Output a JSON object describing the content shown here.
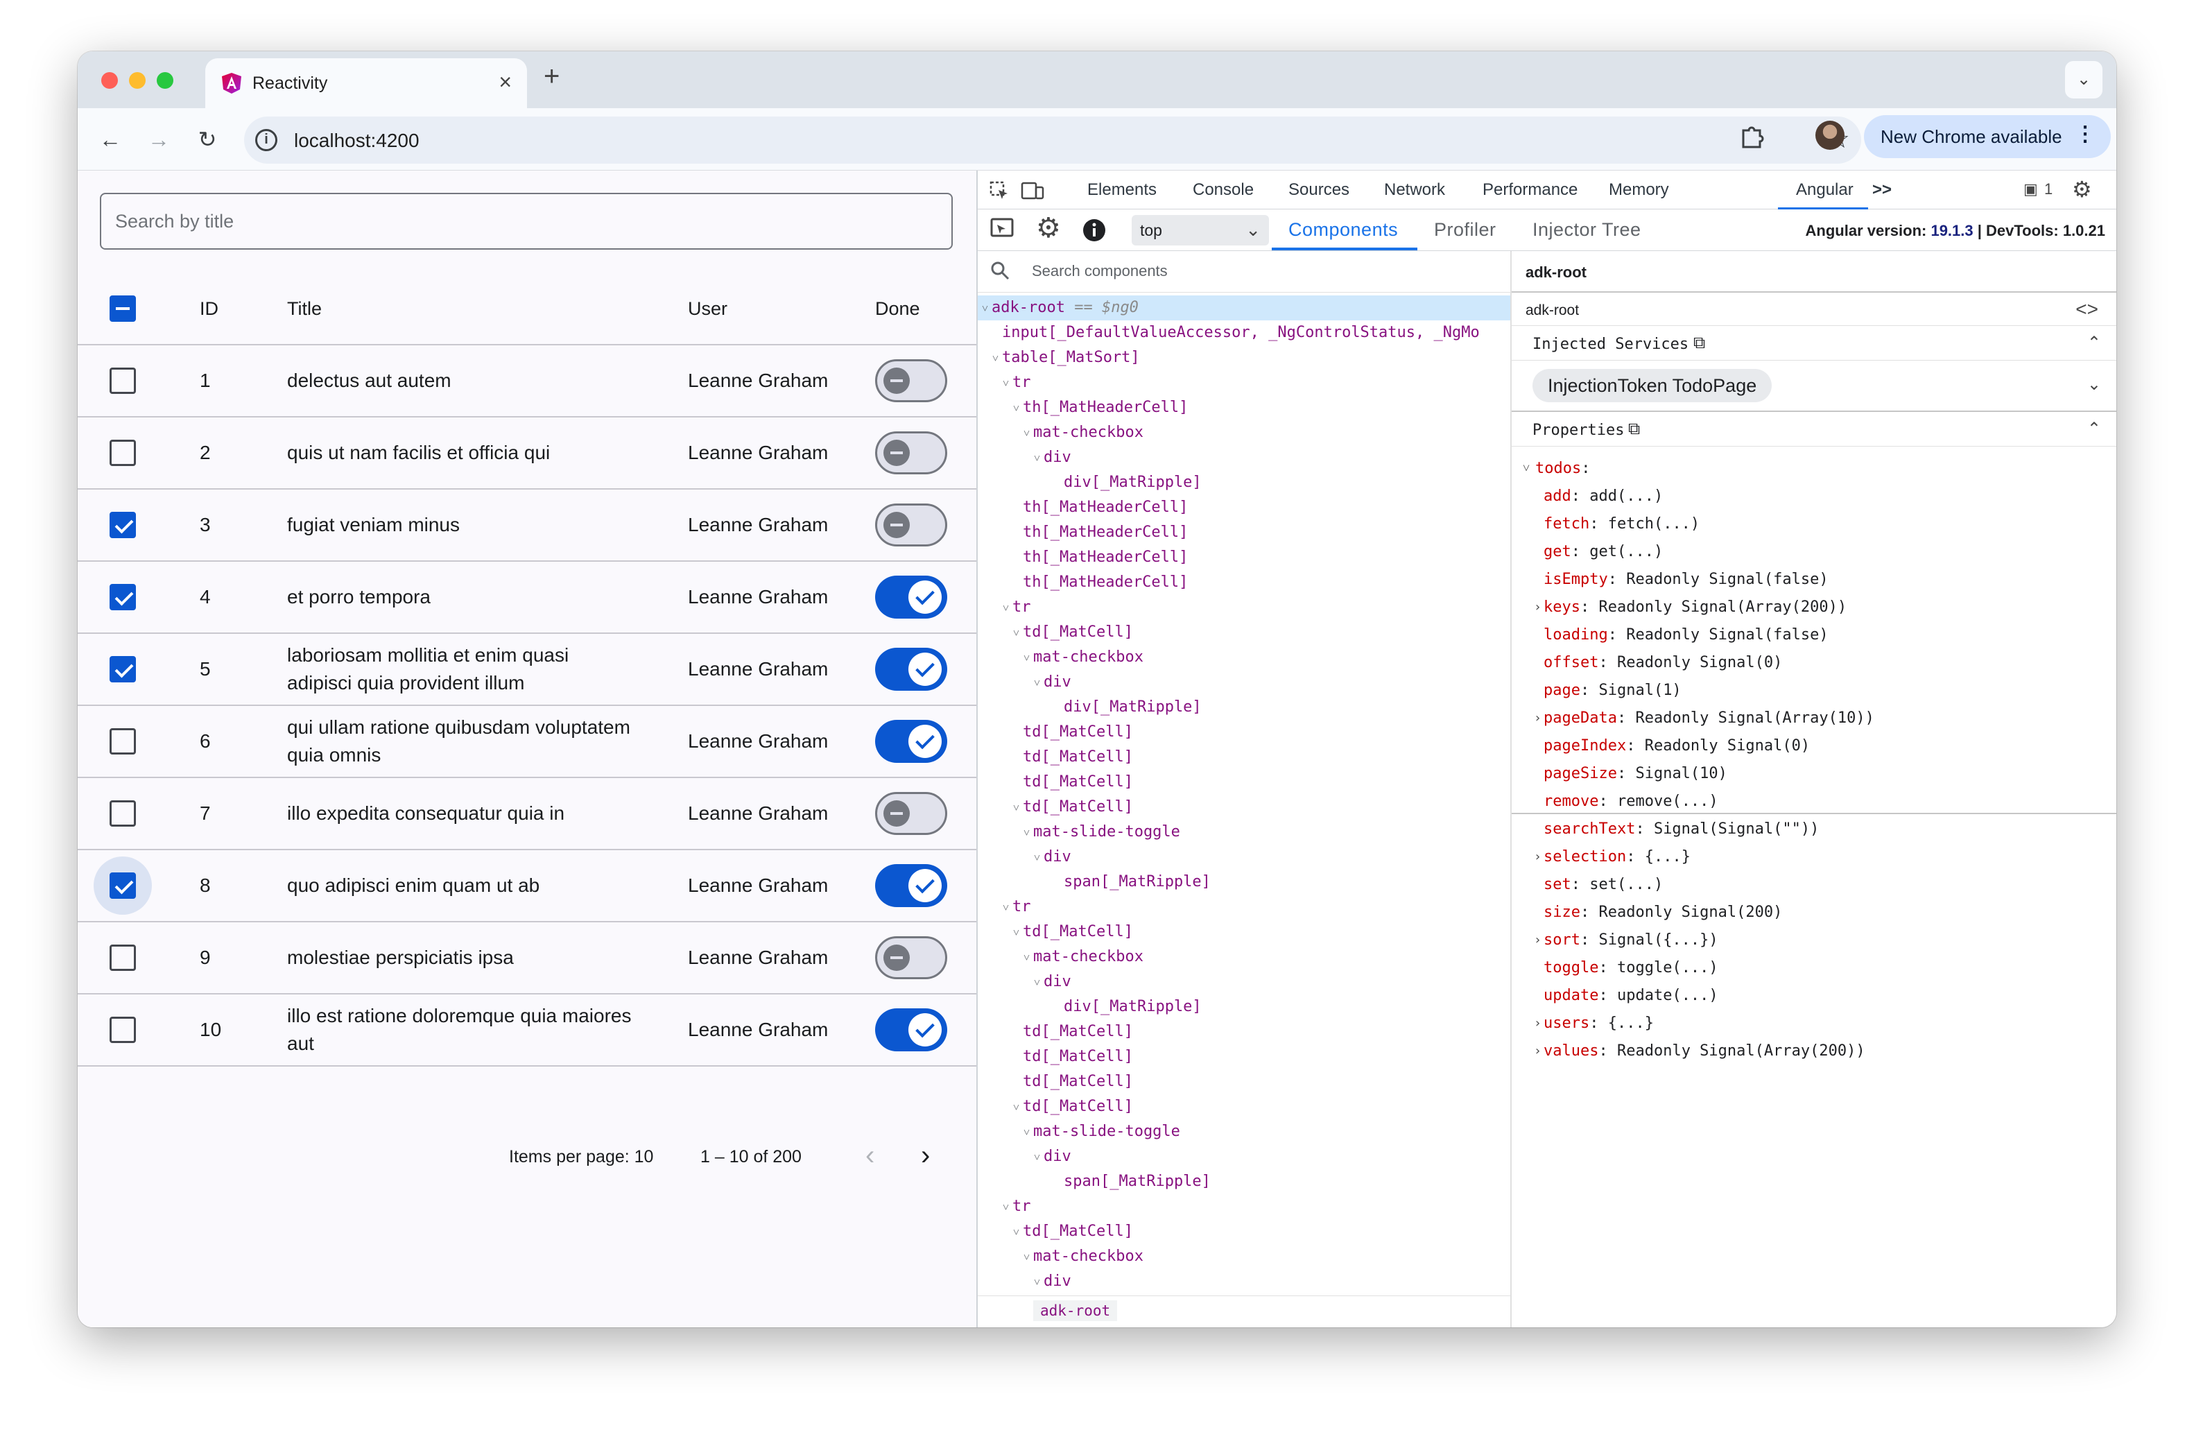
{
  "browser": {
    "tab_title": "Reactivity",
    "tab_close": "×",
    "new_tab": "+",
    "tab_menu": "⌄",
    "url": "localhost:4200",
    "update_label": "New Chrome available",
    "nav": {
      "back": "←",
      "forward": "→",
      "reload": "↻",
      "star": "☆",
      "menu": "⋮"
    }
  },
  "app": {
    "search_placeholder": "Search by title",
    "columns": {
      "id": "ID",
      "title": "Title",
      "user": "User",
      "done": "Done"
    },
    "rows": [
      {
        "id": "1",
        "title": "delectus aut autem",
        "user": "Leanne Graham",
        "selected": false,
        "done": false
      },
      {
        "id": "2",
        "title": "quis ut nam facilis et officia qui",
        "user": "Leanne Graham",
        "selected": false,
        "done": false
      },
      {
        "id": "3",
        "title": "fugiat veniam minus",
        "user": "Leanne Graham",
        "selected": true,
        "done": false
      },
      {
        "id": "4",
        "title": "et porro tempora",
        "user": "Leanne Graham",
        "selected": true,
        "done": true
      },
      {
        "id": "5",
        "title": "laboriosam mollitia et enim quasi adipisci quia provident illum",
        "user": "Leanne Graham",
        "selected": true,
        "done": true
      },
      {
        "id": "6",
        "title": "qui ullam ratione quibusdam voluptatem quia omnis",
        "user": "Leanne Graham",
        "selected": false,
        "done": true
      },
      {
        "id": "7",
        "title": "illo expedita consequatur quia in",
        "user": "Leanne Graham",
        "selected": false,
        "done": false
      },
      {
        "id": "8",
        "title": "quo adipisci enim quam ut ab",
        "user": "Leanne Graham",
        "selected": true,
        "done": true
      },
      {
        "id": "9",
        "title": "molestiae perspiciatis ipsa",
        "user": "Leanne Graham",
        "selected": false,
        "done": false
      },
      {
        "id": "10",
        "title": "illo est ratione doloremque quia maiores aut",
        "user": "Leanne Graham",
        "selected": false,
        "done": true
      }
    ],
    "paginator": {
      "items_per_page": "Items per page: 10",
      "range": "1 – 10 of 200",
      "prev": "‹",
      "next": "›"
    }
  },
  "devtools": {
    "tabs": [
      "Elements",
      "Console",
      "Sources",
      "Network",
      "Performance",
      "Memory",
      "Angular"
    ],
    "more_tabs": ">>",
    "issues_count": "1",
    "angular": {
      "context": "top",
      "subtabs": [
        "Components",
        "Profiler",
        "Injector Tree"
      ],
      "version_label": "Angular version: ",
      "version": "19.1.3",
      "devtools_label": " | DevTools: 1.0.21",
      "search_placeholder": "Search components",
      "breadcrumb": "adk-root",
      "tree": [
        {
          "indent": 0,
          "tw": "˅",
          "text": "adk-root",
          "extra": " == $ng0",
          "selected": true
        },
        {
          "indent": 1,
          "tw": "",
          "text": "input[_DefaultValueAccessor, _NgControlStatus, _NgMo"
        },
        {
          "indent": 1,
          "tw": "˅",
          "text": "table[_MatSort]"
        },
        {
          "indent": 2,
          "tw": "˅",
          "text": "tr"
        },
        {
          "indent": 3,
          "tw": "˅",
          "text": "th[_MatHeaderCell]"
        },
        {
          "indent": 4,
          "tw": "˅",
          "text": "mat-checkbox"
        },
        {
          "indent": 5,
          "tw": "˅",
          "text": "div"
        },
        {
          "indent": 6,
          "tw": "",
          "text": "div[_MatRipple]"
        },
        {
          "indent": 3,
          "tw": "",
          "text": "th[_MatHeaderCell]"
        },
        {
          "indent": 3,
          "tw": "",
          "text": "th[_MatHeaderCell]"
        },
        {
          "indent": 3,
          "tw": "",
          "text": "th[_MatHeaderCell]"
        },
        {
          "indent": 3,
          "tw": "",
          "text": "th[_MatHeaderCell]"
        },
        {
          "indent": 2,
          "tw": "˅",
          "text": "tr"
        },
        {
          "indent": 3,
          "tw": "˅",
          "text": "td[_MatCell]"
        },
        {
          "indent": 4,
          "tw": "˅",
          "text": "mat-checkbox"
        },
        {
          "indent": 5,
          "tw": "˅",
          "text": "div"
        },
        {
          "indent": 6,
          "tw": "",
          "text": "div[_MatRipple]"
        },
        {
          "indent": 3,
          "tw": "",
          "text": "td[_MatCell]"
        },
        {
          "indent": 3,
          "tw": "",
          "text": "td[_MatCell]"
        },
        {
          "indent": 3,
          "tw": "",
          "text": "td[_MatCell]"
        },
        {
          "indent": 3,
          "tw": "˅",
          "text": "td[_MatCell]"
        },
        {
          "indent": 4,
          "tw": "˅",
          "text": "mat-slide-toggle"
        },
        {
          "indent": 5,
          "tw": "˅",
          "text": "div"
        },
        {
          "indent": 6,
          "tw": "",
          "text": "span[_MatRipple]"
        },
        {
          "indent": 2,
          "tw": "˅",
          "text": "tr"
        },
        {
          "indent": 3,
          "tw": "˅",
          "text": "td[_MatCell]"
        },
        {
          "indent": 4,
          "tw": "˅",
          "text": "mat-checkbox"
        },
        {
          "indent": 5,
          "tw": "˅",
          "text": "div"
        },
        {
          "indent": 6,
          "tw": "",
          "text": "div[_MatRipple]"
        },
        {
          "indent": 3,
          "tw": "",
          "text": "td[_MatCell]"
        },
        {
          "indent": 3,
          "tw": "",
          "text": "td[_MatCell]"
        },
        {
          "indent": 3,
          "tw": "",
          "text": "td[_MatCell]"
        },
        {
          "indent": 3,
          "tw": "˅",
          "text": "td[_MatCell]"
        },
        {
          "indent": 4,
          "tw": "˅",
          "text": "mat-slide-toggle"
        },
        {
          "indent": 5,
          "tw": "˅",
          "text": "div"
        },
        {
          "indent": 6,
          "tw": "",
          "text": "span[_MatRipple]"
        },
        {
          "indent": 2,
          "tw": "˅",
          "text": "tr"
        },
        {
          "indent": 3,
          "tw": "˅",
          "text": "td[_MatCell]"
        },
        {
          "indent": 4,
          "tw": "˅",
          "text": "mat-checkbox"
        },
        {
          "indent": 5,
          "tw": "˅",
          "text": "div"
        }
      ],
      "details": {
        "title": "adk-root",
        "component_name": "adk-root",
        "code_icon": "<>",
        "injected_services_label": "Injected Services",
        "token": "InjectionToken TodoPage",
        "properties_label": "Properties",
        "properties": [
          {
            "level": 0,
            "tw": "˅",
            "key": "todos",
            "value": ":"
          },
          {
            "level": 1,
            "tw": "",
            "key": "add",
            "value": ": add(...)"
          },
          {
            "level": 1,
            "tw": "",
            "key": "fetch",
            "value": ": fetch(...)"
          },
          {
            "level": 1,
            "tw": "",
            "key": "get",
            "value": ": get(...)"
          },
          {
            "level": 1,
            "tw": "",
            "key": "isEmpty",
            "value": ": Readonly Signal(false)"
          },
          {
            "level": 1,
            "tw": "›",
            "key": "keys",
            "value": ": Readonly Signal(Array(200))"
          },
          {
            "level": 1,
            "tw": "",
            "key": "loading",
            "value": ": Readonly Signal(false)"
          },
          {
            "level": 1,
            "tw": "",
            "key": "offset",
            "value": ": Readonly Signal(0)"
          },
          {
            "level": 1,
            "tw": "",
            "key": "page",
            "value": ": Signal(1)"
          },
          {
            "level": 1,
            "tw": "›",
            "key": "pageData",
            "value": ": Readonly Signal(Array(10))"
          },
          {
            "level": 1,
            "tw": "",
            "key": "pageIndex",
            "value": ": Readonly Signal(0)"
          },
          {
            "level": 1,
            "tw": "",
            "key": "pageSize",
            "value": ": Signal(10)"
          },
          {
            "level": 1,
            "tw": "",
            "key": "remove",
            "value": ": remove(...)"
          },
          {
            "level": 1,
            "tw": "",
            "key": "searchText",
            "value": ": Signal(Signal(\"\"))"
          },
          {
            "level": 1,
            "tw": "›",
            "key": "selection",
            "value": ": {...}"
          },
          {
            "level": 1,
            "tw": "",
            "key": "set",
            "value": ": set(...)"
          },
          {
            "level": 1,
            "tw": "",
            "key": "size",
            "value": ": Readonly Signal(200)"
          },
          {
            "level": 1,
            "tw": "›",
            "key": "sort",
            "value": ": Signal({...})"
          },
          {
            "level": 1,
            "tw": "",
            "key": "toggle",
            "value": ": toggle(...)"
          },
          {
            "level": 1,
            "tw": "",
            "key": "update",
            "value": ": update(...)"
          },
          {
            "level": 1,
            "tw": "›",
            "key": "users",
            "value": ": {...}"
          },
          {
            "level": 1,
            "tw": "›",
            "key": "values",
            "value": ": Readonly Signal(Array(200))"
          }
        ]
      }
    }
  },
  "colors": {
    "accent": "#0b57d0",
    "devtools_blue": "#1a73e8",
    "tag_purple": "#881280",
    "prop_key_red": "#c80000"
  }
}
